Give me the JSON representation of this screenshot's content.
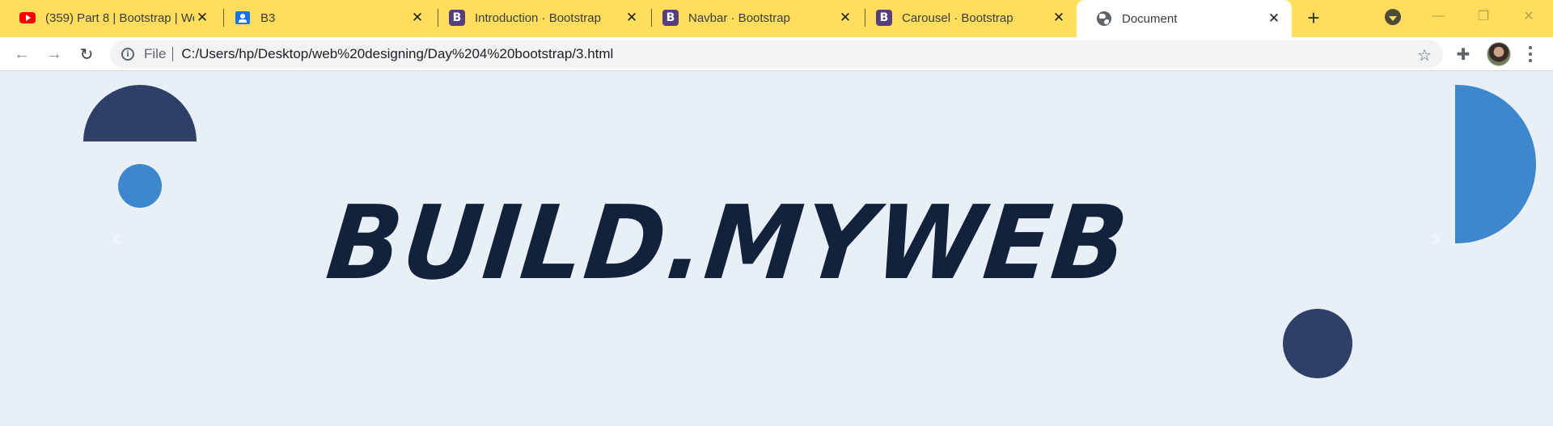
{
  "tabs": [
    {
      "title": "(359) Part 8 | Bootstrap | We",
      "icon": "youtube-icon"
    },
    {
      "title": "B3",
      "icon": "classroom-icon"
    },
    {
      "title": "Introduction · Bootstrap",
      "icon": "bootstrap-icon"
    },
    {
      "title": "Navbar · Bootstrap",
      "icon": "bootstrap-icon"
    },
    {
      "title": "Carousel · Bootstrap",
      "icon": "bootstrap-icon"
    },
    {
      "title": "Document",
      "icon": "globe-icon",
      "active": true
    }
  ],
  "bootstrap_icon_letter": "B",
  "new_tab_label": "+",
  "close_glyph": "✕",
  "window_controls": {
    "minimize": "—",
    "restore": "❐",
    "close": "✕"
  },
  "toolbar": {
    "back": "←",
    "forward": "→",
    "reload": "↻",
    "info_glyph": "i",
    "scheme": "File",
    "url": "C:/Users/hp/Desktop/web%20designing/Day%204%20bootstrap/3.html",
    "star": "☆",
    "extensions": "✚"
  },
  "page": {
    "brand_text": "BUILD.MYWEB",
    "prev_arrow": "‹",
    "next_arrow": "›"
  },
  "colors": {
    "tab_strip": "#fede5c",
    "page_background": "#e8eff6",
    "navy": "#2e4068",
    "blue": "#3d87cc",
    "brand_text": "#12223d"
  }
}
